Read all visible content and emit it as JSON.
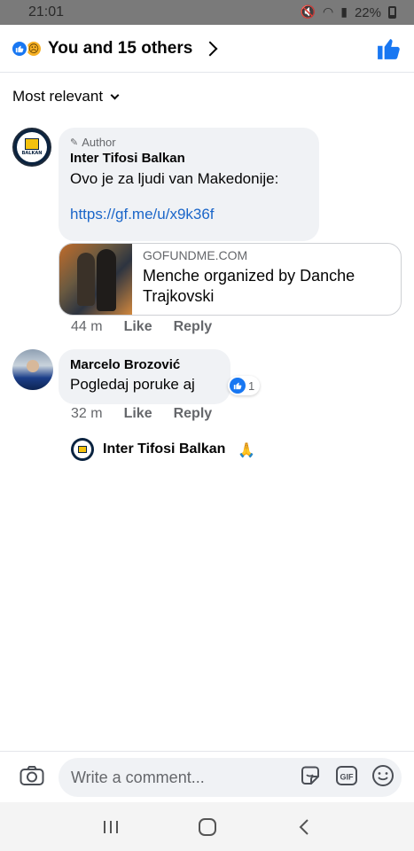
{
  "status_bar": {
    "time": "21:01",
    "battery": "22%"
  },
  "header": {
    "reactions": [
      "like",
      "sad"
    ],
    "title": "You and 15 others"
  },
  "sort": {
    "label": "Most relevant"
  },
  "comments": [
    {
      "badge": "Author",
      "name": "Inter Tifosi Balkan",
      "text": "Ovo je za ljudi van Makedonije:",
      "link": "https://gf.me/u/x9k36f",
      "link_preview": {
        "domain": "GOFUNDME.COM",
        "title": "Menche organized by Danche Trajkovski"
      },
      "time": "44 m",
      "like_label": "Like",
      "reply_label": "Reply"
    },
    {
      "name": "Marcelo Brozović",
      "text": "Pogledaj poruke aj",
      "reaction_count": "1",
      "time": "32 m",
      "like_label": "Like",
      "reply_label": "Reply",
      "reply_preview": {
        "name": "Inter Tifosi Balkan",
        "emoji": "🙏"
      }
    }
  ],
  "composer": {
    "placeholder": "Write a comment..."
  },
  "avatar_text": "BALKAN",
  "colors": {
    "accent": "#1877f2",
    "link": "#1b66c9",
    "bubble": "#f0f2f5",
    "secondary_text": "#65676b"
  },
  "icons": [
    "camera-icon",
    "sticker-icon",
    "gif-icon",
    "emoji-icon",
    "like-thumb-icon",
    "recent-apps-icon",
    "home-icon",
    "back-icon"
  ]
}
